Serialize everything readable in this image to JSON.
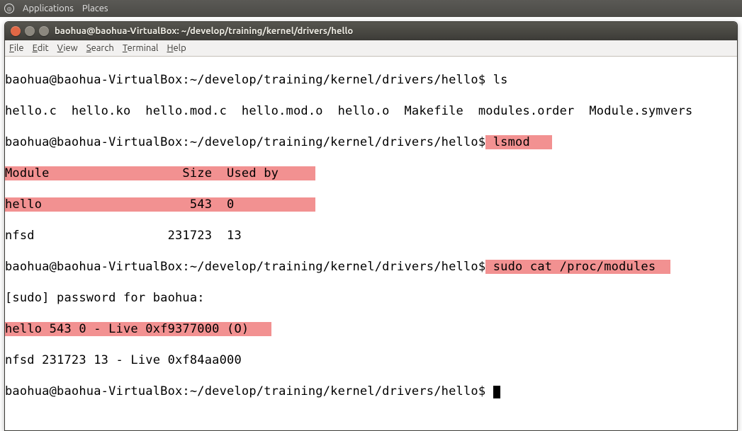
{
  "top_panel": {
    "applications": "Applications",
    "places": "Places"
  },
  "window": {
    "title": "baohua@baohua-VirtualBox: ~/develop/training/kernel/drivers/hello"
  },
  "menubar": {
    "file": "File",
    "edit": "Edit",
    "view": "View",
    "search": "Search",
    "terminal": "Terminal",
    "help": "Help"
  },
  "term": {
    "l1_prompt": "baohua@baohua-VirtualBox:~/develop/training/kernel/drivers/hello$ ",
    "l1_cmd": "ls",
    "l2": "hello.c  hello.ko  hello.mod.c  hello.mod.o  hello.o  Makefile  modules.order  Module.symvers",
    "l3_prompt": "baohua@baohua-VirtualBox:~/develop/training/kernel/drivers/hello$",
    "l3_cmd": " lsmod   ",
    "l4_hdr": "Module                  Size  Used by     ",
    "l5_hello": "hello                    543  0           ",
    "l6": "nfsd                  231723  13",
    "l7_prompt": "baohua@baohua-VirtualBox:~/develop/training/kernel/drivers/hello$",
    "l7_cmd": " sudo cat /proc/modules  ",
    "l8": "[sudo] password for baohua:",
    "l9_hello": "hello 543 0 - Live 0xf9377000 (O)   ",
    "l10": "nfsd 231723 13 - Live 0xf84aa000",
    "l11_prompt": "baohua@baohua-VirtualBox:~/develop/training/kernel/drivers/hello$ "
  }
}
